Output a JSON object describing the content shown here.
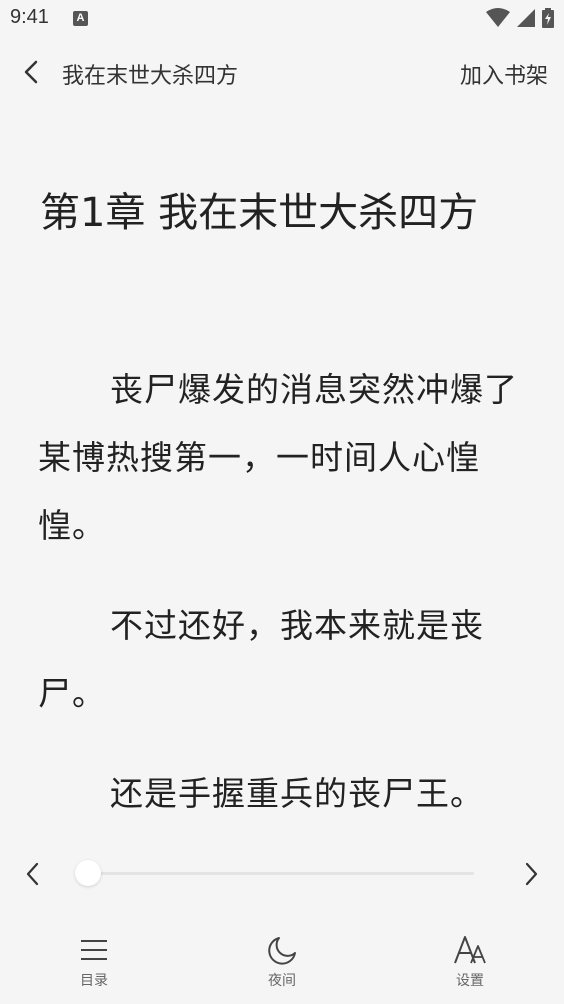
{
  "status_bar": {
    "time": "9:41",
    "notification_badge": "A"
  },
  "header": {
    "book_title": "我在末世大杀四方",
    "add_to_shelf_label": "加入书架"
  },
  "chapter": {
    "title": "第1章  我在末世大杀四方",
    "paragraphs": [
      "丧尸爆发的消息突然冲爆了某博热搜第一，一时间人心惶惶。",
      "不过还好，我本来就是丧尸。",
      "还是手握重兵的丧尸王。"
    ]
  },
  "progress": {
    "value": 0
  },
  "bottom_nav": {
    "items": [
      {
        "label": "目录",
        "icon": "menu-list-icon"
      },
      {
        "label": "夜间",
        "icon": "moon-icon"
      },
      {
        "label": "设置",
        "icon": "font-settings-icon"
      }
    ]
  },
  "colors": {
    "background": "#f5f5f5",
    "text": "#222222",
    "muted": "#666666"
  }
}
